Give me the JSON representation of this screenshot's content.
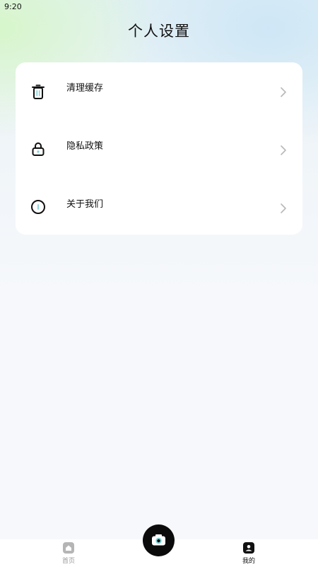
{
  "status_bar": {
    "time": "9:20"
  },
  "page": {
    "title": "个人设置"
  },
  "settings": {
    "items": [
      {
        "label": "清理缓存",
        "icon": "trash-icon"
      },
      {
        "label": "隐私政策",
        "icon": "lock-icon"
      },
      {
        "label": "关于我们",
        "icon": "info-icon"
      }
    ]
  },
  "bottom_nav": {
    "items": [
      {
        "label": "首页",
        "icon": "home-icon",
        "active": false
      },
      {
        "label": "我的",
        "icon": "profile-icon",
        "active": true
      }
    ],
    "center_button": {
      "icon": "camera-icon"
    }
  },
  "colors": {
    "accent": "#7fd3d8",
    "text_primary": "#111111",
    "text_inactive": "#9a9a9a",
    "chevron": "#b8b8b8",
    "card_bg": "#ffffff",
    "page_bg": "#f6f8fb"
  }
}
